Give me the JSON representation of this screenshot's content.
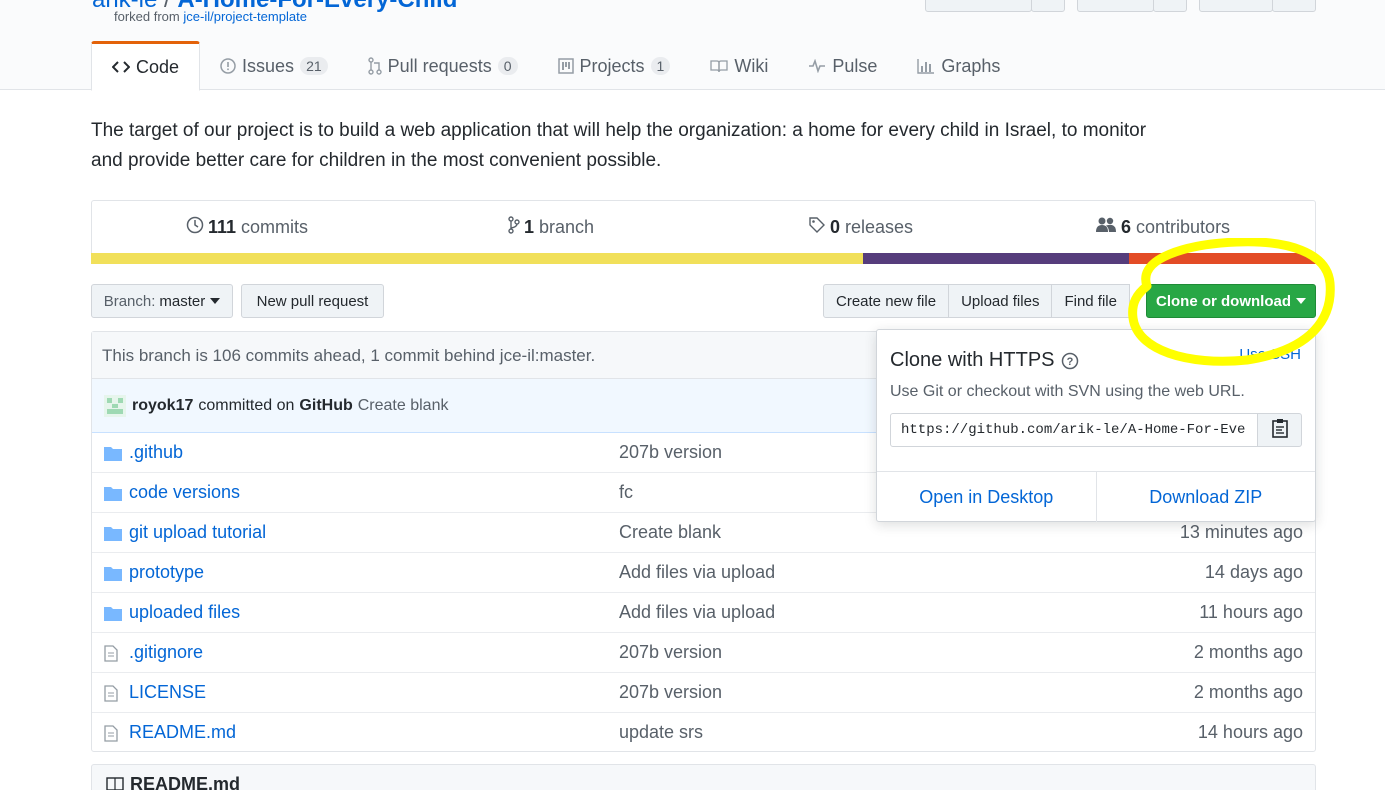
{
  "repo": {
    "owner": "arik-le",
    "separator": "/",
    "name": "A-Home-For-Every-Child",
    "forked_prefix": "forked from",
    "forked_from": "jce-il/project-template"
  },
  "tabs": [
    {
      "label": "Code",
      "icon": "code-icon"
    },
    {
      "label": "Issues",
      "count": "21",
      "icon": "issue-icon"
    },
    {
      "label": "Pull requests",
      "count": "0",
      "icon": "pull-request-icon"
    },
    {
      "label": "Projects",
      "count": "1",
      "icon": "project-icon"
    },
    {
      "label": "Wiki",
      "icon": "book-icon"
    },
    {
      "label": "Pulse",
      "icon": "pulse-icon"
    },
    {
      "label": "Graphs",
      "icon": "graph-icon"
    }
  ],
  "description": "The target of our project is to build a web application that will help the organization: a home for every child in Israel, to monitor and provide better care for children in the most convenient possible.",
  "summary": {
    "commits_num": "111",
    "commits_label": "commits",
    "branch_num": "1",
    "branch_label": "branch",
    "releases_num": "0",
    "releases_label": "releases",
    "contributors_num": "6",
    "contributors_label": "contributors"
  },
  "language_bar": [
    {
      "color": "#f1e05a",
      "fraction": 0.63
    },
    {
      "color": "#563d7c",
      "fraction": 0.217
    },
    {
      "color": "#e34c26",
      "fraction": 0.153
    }
  ],
  "toolbar": {
    "branch_prefix": "Branch:",
    "branch_name": "master",
    "new_pr": "New pull request",
    "create_file": "Create new file",
    "upload_files": "Upload files",
    "find_file": "Find file",
    "clone_download": "Clone or download"
  },
  "branch_status": "This branch is 106 commits ahead, 1 commit behind jce-il:master.",
  "latest_commit": {
    "author": "royok17",
    "middle": "committed on",
    "committer": "GitHub",
    "message": "Create blank"
  },
  "files": [
    {
      "name": ".github",
      "type": "dir",
      "message": "207b version",
      "age": ""
    },
    {
      "name": "code versions",
      "type": "dir",
      "message": "fc",
      "age": ""
    },
    {
      "name": "git upload tutorial",
      "type": "dir",
      "message": "Create blank",
      "age": "13 minutes ago"
    },
    {
      "name": "prototype",
      "type": "dir",
      "message": "Add files via upload",
      "age": "14 days ago"
    },
    {
      "name": "uploaded files",
      "type": "dir",
      "message": "Add files via upload",
      "age": "11 hours ago"
    },
    {
      "name": ".gitignore",
      "type": "file",
      "message": "207b version",
      "age": "2 months ago"
    },
    {
      "name": "LICENSE",
      "type": "file",
      "message": "207b version",
      "age": "2 months ago"
    },
    {
      "name": "README.md",
      "type": "file",
      "message": "update srs",
      "age": "14 hours ago"
    }
  ],
  "readme_title": "README.md",
  "clone_popup": {
    "title": "Clone with HTTPS",
    "use_ssh": "Use SSH",
    "subtitle": "Use Git or checkout with SVN using the web URL.",
    "url": "https://github.com/arik-le/A-Home-For-Every-Child.git",
    "open_desktop": "Open in Desktop",
    "download_zip": "Download ZIP"
  },
  "colors": {
    "accent_link": "#0366d6",
    "green_button": "#28a745",
    "highlight": "#ffff00",
    "active_tab": "#e36209"
  }
}
